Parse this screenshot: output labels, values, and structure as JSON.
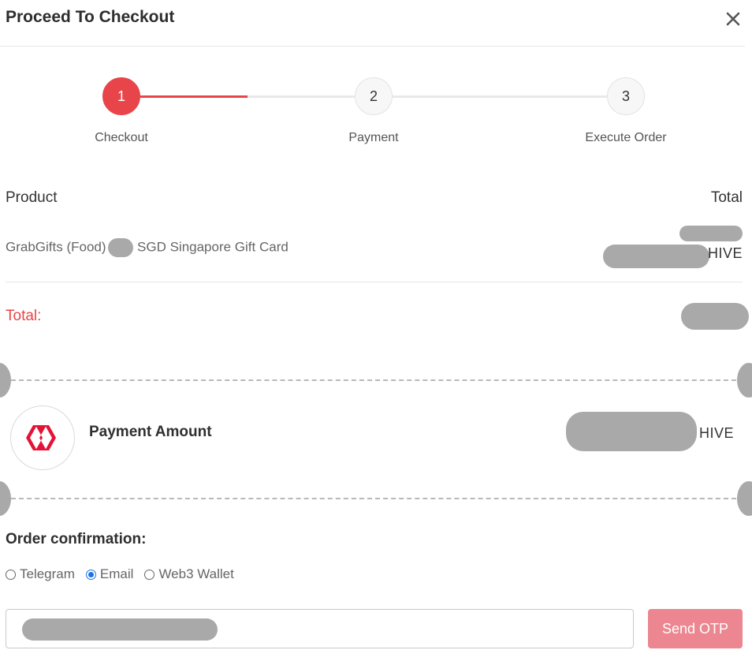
{
  "modal": {
    "title": "Proceed To Checkout"
  },
  "steps": [
    {
      "number": "1",
      "label": "Checkout",
      "active": true
    },
    {
      "number": "2",
      "label": "Payment",
      "active": false
    },
    {
      "number": "3",
      "label": "Execute Order",
      "active": false
    }
  ],
  "order_table": {
    "product_header": "Product",
    "total_header": "Total",
    "product_name_prefix": "GrabGifts (Food)",
    "product_name_suffix": "SGD Singapore Gift Card",
    "currency": "HIVE",
    "total_label": "Total:"
  },
  "payment": {
    "label": "Payment Amount",
    "currency": "HIVE",
    "logo_icon": "hive-logo-icon"
  },
  "order_confirmation": {
    "label": "Order confirmation:",
    "options": [
      "Telegram",
      "Email",
      "Web3 Wallet"
    ],
    "selected": "Email"
  },
  "otp": {
    "button_label": "Send OTP"
  },
  "colors": {
    "accent": "#e8454a",
    "otp_button": "#ec8690",
    "radio_checked": "#1a73e8"
  }
}
